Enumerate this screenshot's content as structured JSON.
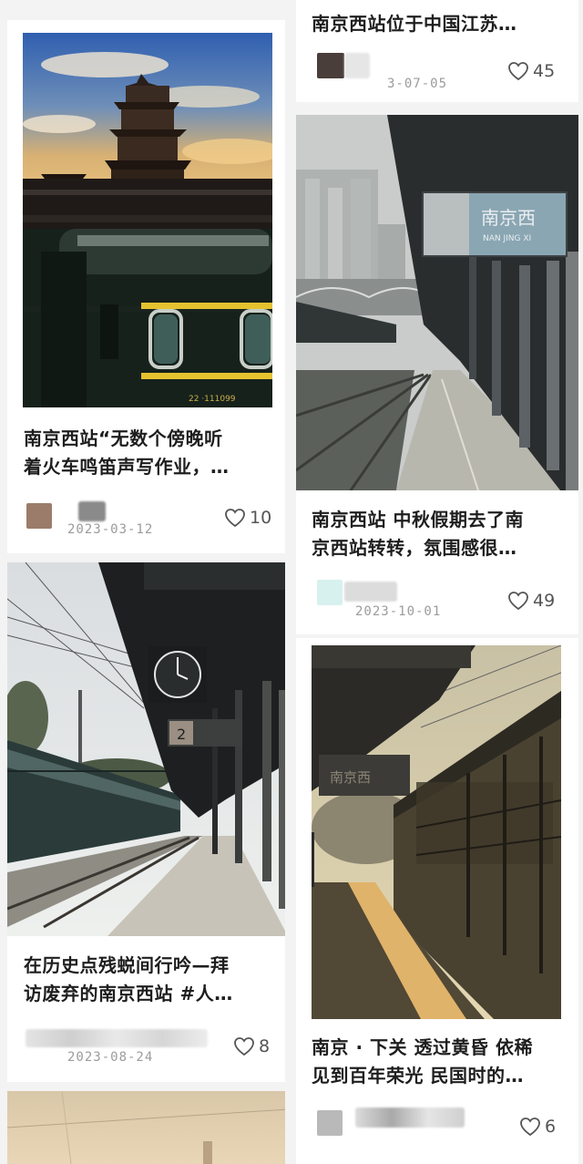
{
  "feed": {
    "col_left": [
      {
        "title_line1": "南京西站“无数个傍晚听",
        "title_line2": "着火车鸣笛声写作业，…",
        "date": "2023-03-12",
        "likes": "10",
        "icon": "heart-outline-icon"
      },
      {
        "title_line1": "在历史点残蜕间行吟—拜",
        "title_line2": "访废弃的南京西站 #人…",
        "date": "2023-08-24",
        "likes": "8",
        "icon": "heart-outline-icon"
      }
    ],
    "col_right": [
      {
        "title_line1": "南京西站位于中国江苏…",
        "date": "3-07-05",
        "likes": "45",
        "icon": "heart-outline-icon"
      },
      {
        "title_line1": "南京西站 中秋假期去了南",
        "title_line2": "京西站转转，氛围感很…",
        "date": "2023-10-01",
        "likes": "49",
        "icon": "heart-outline-icon"
      },
      {
        "title_line1": "南京 · 下关 透过黄昏 依稀",
        "title_line2": "见到百年荣光 民国时的…",
        "date": "",
        "likes": "6",
        "icon": "heart-outline-icon"
      }
    ],
    "sign_text": "南京西",
    "sign_pinyin": "NAN JING XI",
    "platform_number": "2",
    "train_number": "22 ·111099"
  },
  "colors": {
    "accent": "#e5b41e",
    "text": "#1e1e1e",
    "muted": "#9b9b9b"
  }
}
